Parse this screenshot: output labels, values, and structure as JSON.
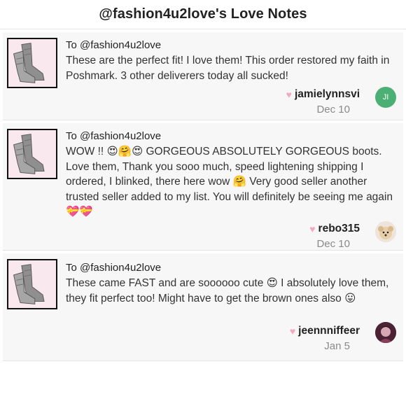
{
  "header": {
    "title": "@fashion4u2love's Love Notes"
  },
  "notes": [
    {
      "to": "To @fashion4u2love",
      "message": "These are the perfect fit! I love them! This order restored my faith in Poshmark. 3 other deliverers today all sucked!",
      "username": "jamielynnsvi",
      "date": "Dec 10",
      "avatar_initials": "JI"
    },
    {
      "to": "To @fashion4u2love",
      "message": "WOW !! 😍🤗😍 GORGEOUS ABSOLUTELY GORGEOUS boots. Love them, Thank you sooo much, speed lightening shipping I ordered, I blinked, there here wow 🤗 Very good seller another trusted seller added to my list. You will definitely be seeing me again 💝💝",
      "username": "rebo315",
      "date": "Dec 10"
    },
    {
      "to": "To @fashion4u2love",
      "message": "These came FAST and are soooooo cute 😍 I absolutely love them, they fit perfect too! Might have to get the brown ones also 😛",
      "username": "jeennniffeer",
      "date": "Jan 5"
    }
  ],
  "icons": {
    "heart": "♥"
  },
  "colors": {
    "heart": "#f5a9bd",
    "avatar_green": "#4caf73",
    "date": "#8a8a8a"
  }
}
